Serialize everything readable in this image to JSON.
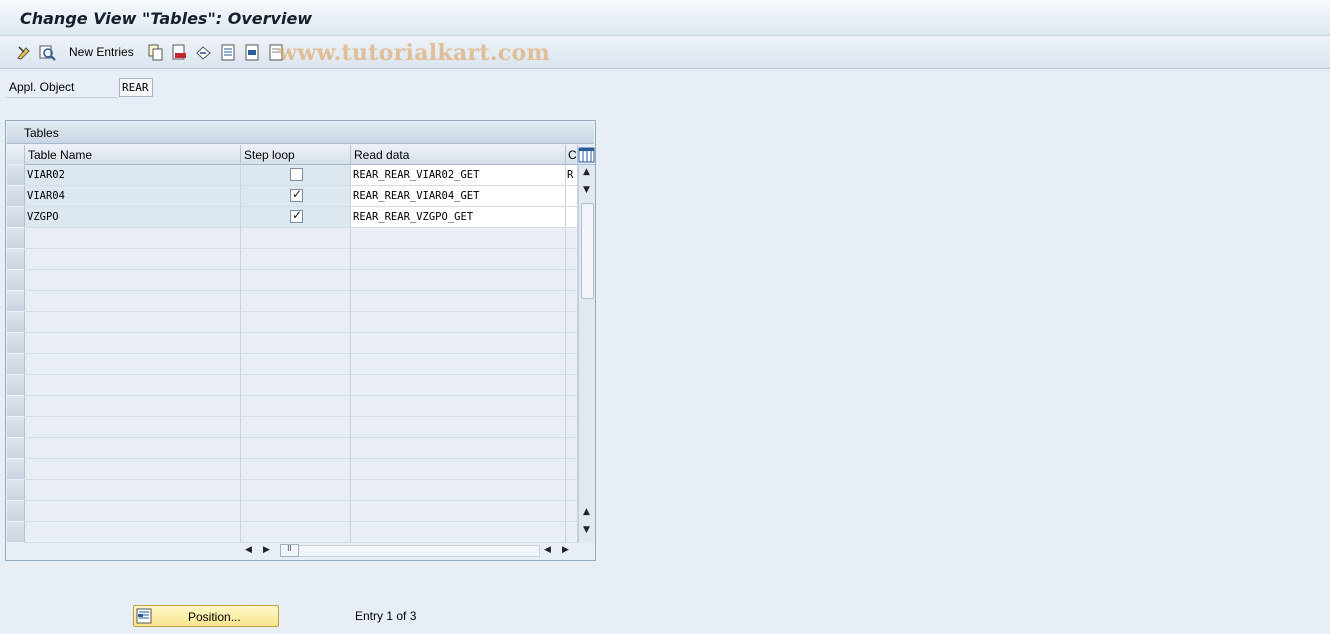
{
  "window": {
    "title": "Change View \"Tables\": Overview"
  },
  "toolbar": {
    "new_entries_label": "New Entries",
    "watermark": "www.tutorialkart.com",
    "icons": [
      "display-change-icon",
      "where-used-icon",
      "copy-icon",
      "delete-icon",
      "undo-icon",
      "select-all-icon",
      "select-block-icon",
      "deselect-all-icon"
    ]
  },
  "header_field": {
    "label": "Appl. Object",
    "value": "REAR"
  },
  "table": {
    "title": "Tables",
    "columns": [
      "Table Name",
      "Step loop",
      "Read data",
      "C"
    ],
    "rows": [
      {
        "table_name": "VIAR02",
        "step_loop": false,
        "read_data": "REAR_REAR_VIAR02_GET",
        "c": "R"
      },
      {
        "table_name": "VIAR04",
        "step_loop": true,
        "read_data": "REAR_REAR_VIAR04_GET",
        "c": ""
      },
      {
        "table_name": "VZGPO",
        "step_loop": true,
        "read_data": "REAR_REAR_VZGPO_GET",
        "c": ""
      }
    ],
    "visible_row_count": 18
  },
  "footer": {
    "position_button_label": "Position...",
    "entry_text": "Entry 1 of 3"
  },
  "colors": {
    "background": "#e8eef5",
    "position_button": "#f6e58a",
    "watermark": "#dea05a"
  }
}
